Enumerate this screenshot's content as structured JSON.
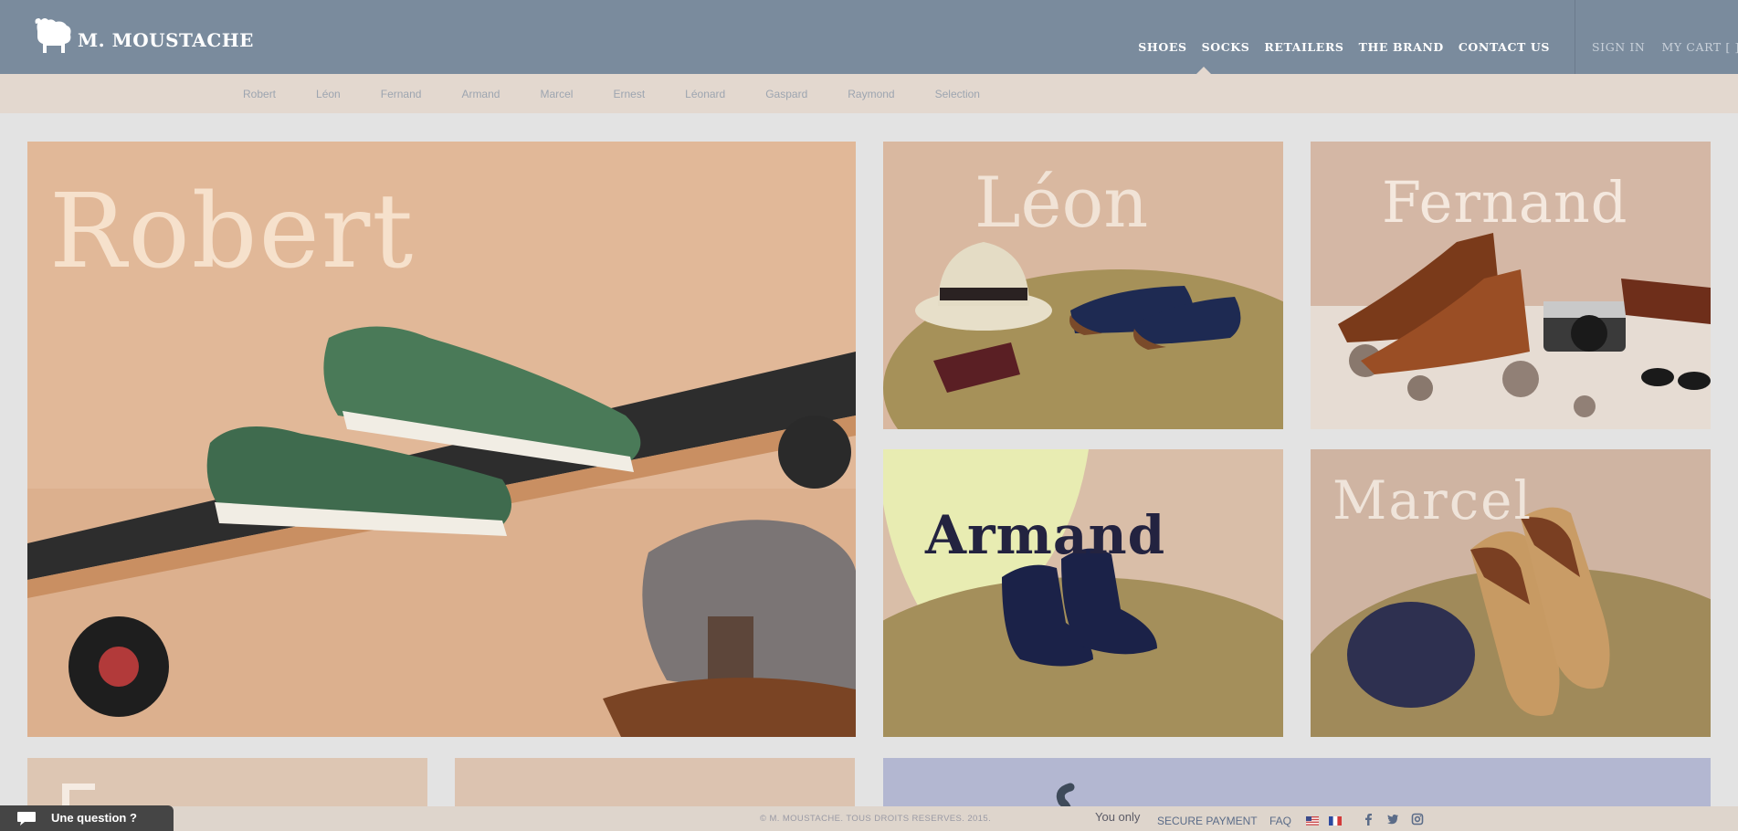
{
  "header": {
    "brand": "M. MOUSTACHE",
    "nav": [
      {
        "label": "SHOES",
        "active": true
      },
      {
        "label": "SOCKS"
      },
      {
        "label": "RETAILERS"
      },
      {
        "label": "THE BRAND"
      },
      {
        "label": "CONTACT US"
      }
    ],
    "account": {
      "sign_in": "SIGN IN",
      "cart": "MY CART [ ]"
    }
  },
  "subnav": [
    "Robert",
    "Léon",
    "Fernand",
    "Armand",
    "Marcel",
    "Ernest",
    "Léonard",
    "Gaspard",
    "Raymond",
    "Selection"
  ],
  "tiles": {
    "robert": "Robert",
    "leon": "Léon",
    "fernand": "Fernand",
    "armand": "Armand",
    "marcel": "Marcel"
  },
  "footer": {
    "copyright": "© M. MOUSTACHE. TOUS DROITS RESERVES. 2015.",
    "you_only": "You only",
    "secure_payment": "SECURE PAYMENT",
    "faq": "FAQ"
  },
  "chat": {
    "label": "Une question ?"
  },
  "colors": {
    "header_bg": "#7a8b9d",
    "subnav_bg": "#e3d8cf",
    "page_bg": "#e3e3e3"
  },
  "icons": [
    "sheep-logo-icon",
    "us-flag-icon",
    "fr-flag-icon",
    "facebook-icon",
    "twitter-icon",
    "instagram-icon",
    "chat-bubble-icon"
  ]
}
